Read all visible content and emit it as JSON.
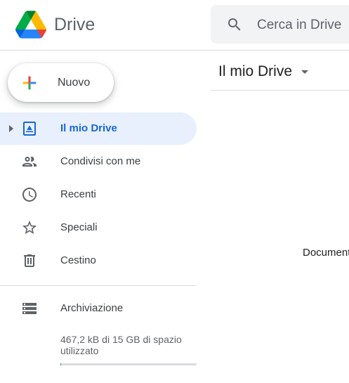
{
  "app": {
    "name": "Drive"
  },
  "search": {
    "placeholder": "Cerca in Drive"
  },
  "new_button": {
    "label": "Nuovo"
  },
  "nav": {
    "items": [
      {
        "label": "Il mio Drive",
        "icon": "my-drive-icon",
        "active": true
      },
      {
        "label": "Condivisi con me",
        "icon": "shared-people-icon",
        "active": false
      },
      {
        "label": "Recenti",
        "icon": "clock-icon",
        "active": false
      },
      {
        "label": "Speciali",
        "icon": "star-icon",
        "active": false
      },
      {
        "label": "Cestino",
        "icon": "trash-icon",
        "active": false
      }
    ],
    "storage_item": {
      "label": "Archiviazione",
      "icon": "storage-icon"
    }
  },
  "storage": {
    "usage_text": "467,2 kB di 15 GB di spazio utilizzato",
    "used_fraction": 3e-05
  },
  "main": {
    "title": "Il mio Drive",
    "empty_text": "Documenti"
  },
  "colors": {
    "accent": "#1967d2",
    "active_bg": "#e8f0fe",
    "divider": "#dadce0"
  }
}
